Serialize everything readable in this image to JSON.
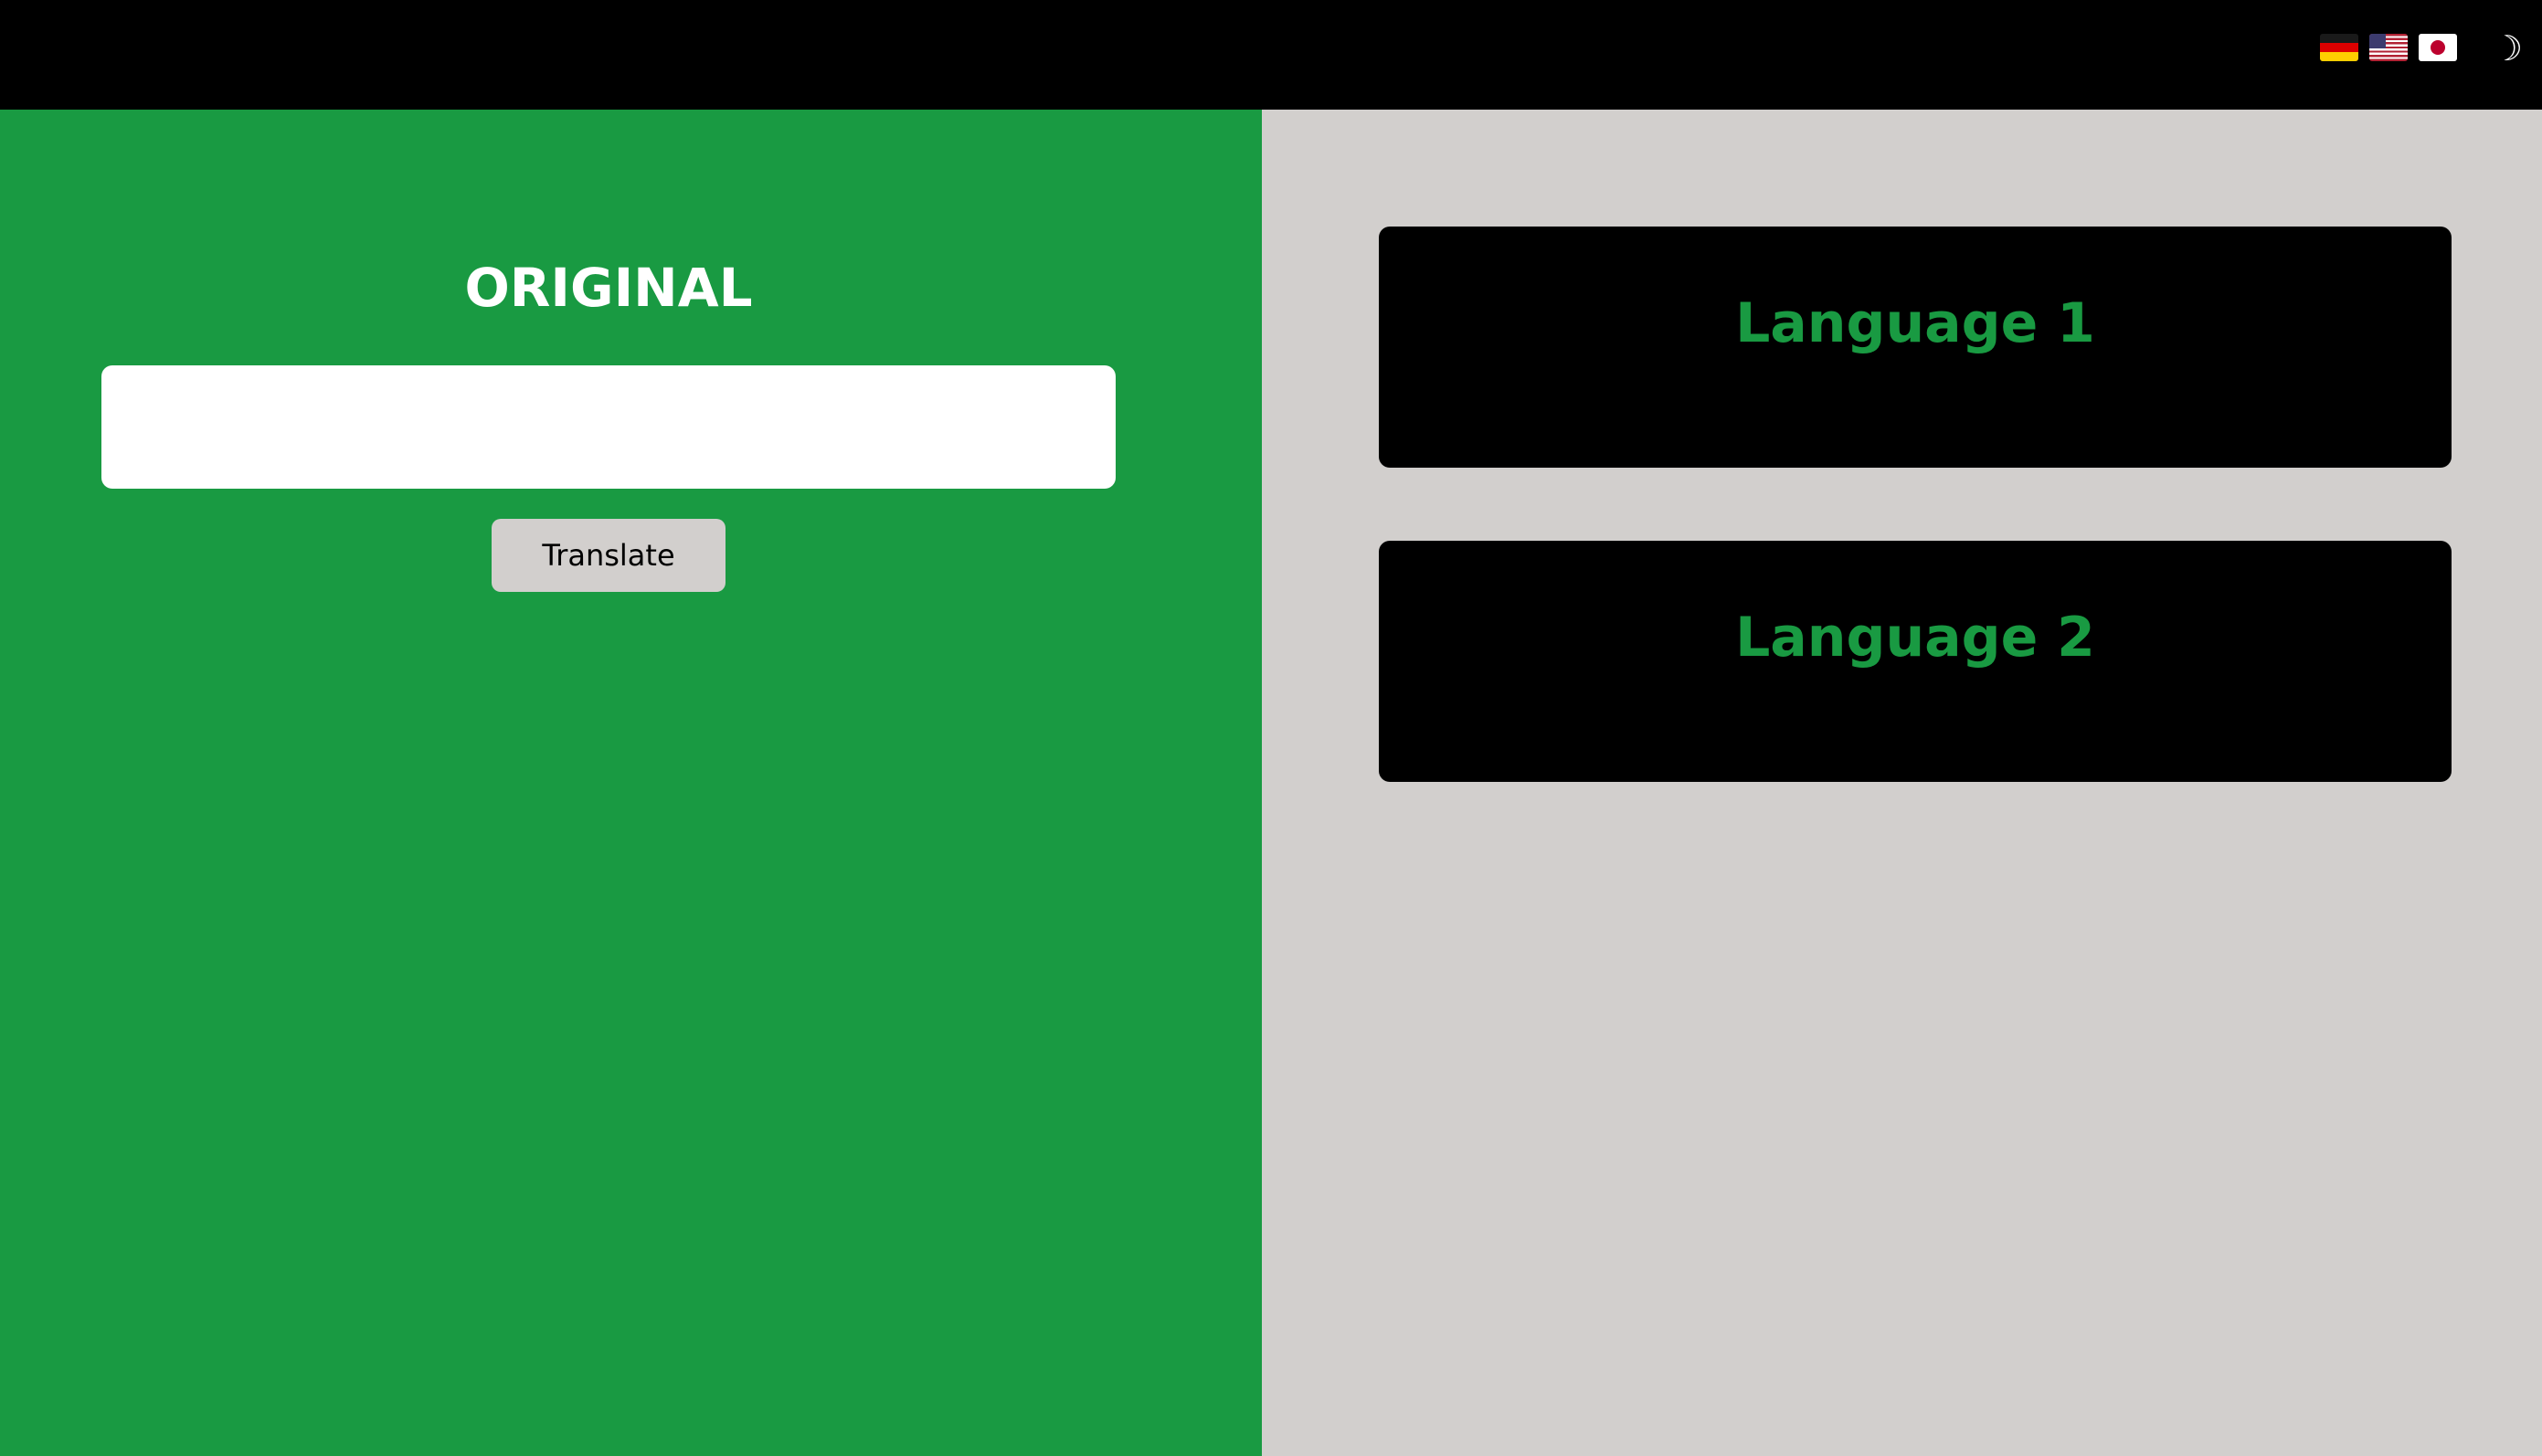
{
  "topbar": {
    "flags": [
      {
        "icon": "germany-flag-icon",
        "label": "German"
      },
      {
        "icon": "usa-flag-icon",
        "label": "English"
      },
      {
        "icon": "japan-flag-icon",
        "label": "Japanese"
      }
    ],
    "theme_toggle_glyph": "☽"
  },
  "original": {
    "title": "ORIGINAL",
    "input_value": "",
    "translate_label": "Translate"
  },
  "outputs": {
    "language_1": "Language 1",
    "language_2": "Language 2"
  },
  "colors": {
    "accent_green": "#199a42",
    "topbar_bg": "#000000",
    "panel_gray": "#d2cfcd",
    "card_bg": "#000000"
  }
}
